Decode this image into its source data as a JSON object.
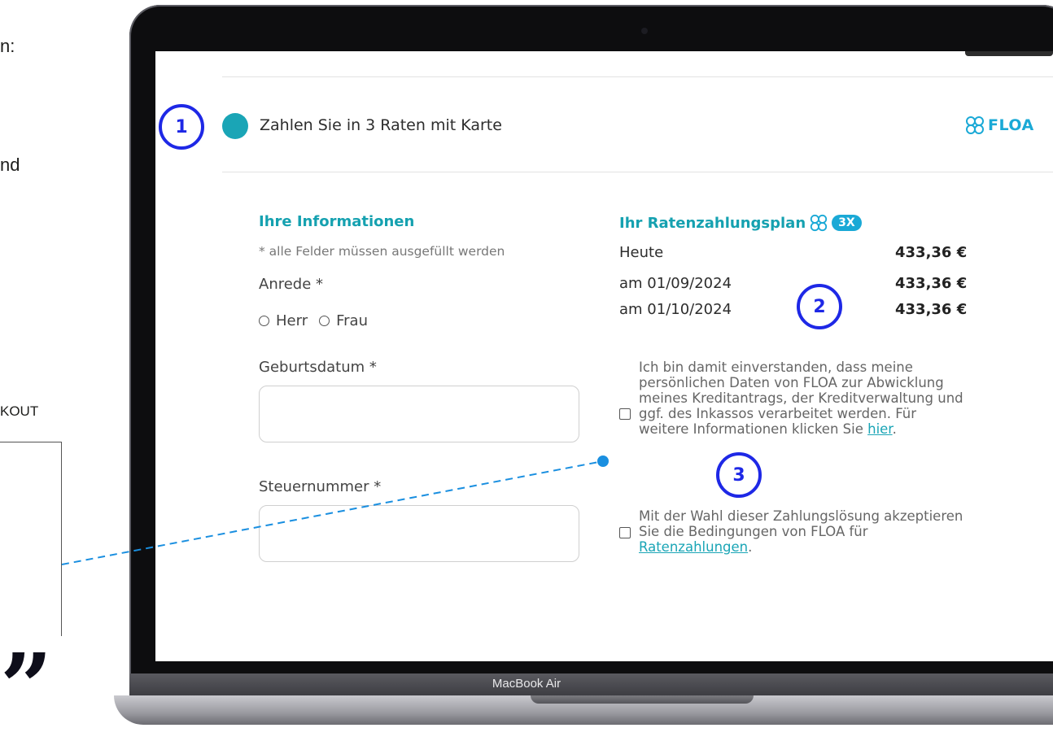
{
  "left_panel": {
    "fragment_1": "n:",
    "fragment_2": "nd",
    "fragment_3": "KOUT",
    "quote_mark": "”"
  },
  "laptop": {
    "brand": "MacBook Air"
  },
  "payment": {
    "option_label": "Zahlen Sie in 3 Raten mit Karte",
    "provider": "FLOA",
    "selected_color": "#1aa5b6",
    "provider_color": "#1aa9d6"
  },
  "info": {
    "title": "Ihre Informationen",
    "required_note": "* alle Felder müssen ausgefüllt werden",
    "salutation_label": "Anrede *",
    "salutation_options": [
      "Herr",
      "Frau"
    ],
    "birthdate_label": "Geburtsdatum *",
    "birthdate_value": "",
    "tax_label": "Steuernummer *",
    "tax_value": ""
  },
  "plan": {
    "title": "Ihr Ratenzahlungsplan",
    "badge": "3X",
    "rows": [
      {
        "date": "Heute",
        "amount": "433,36 €"
      },
      {
        "date": "am 01/09/2024",
        "amount": "433,36 €"
      },
      {
        "date": "am 01/10/2024",
        "amount": "433,36 €"
      }
    ]
  },
  "consent": {
    "first_text": "Ich bin damit einverstanden, dass meine persönlichen Daten von FLOA zur Abwicklung meines Kreditantrags, der Kreditverwaltung und ggf. des Inkassos verarbeitet werden. Für weitere Informationen klicken Sie ",
    "first_link": "hier",
    "first_end": ".",
    "second_text": "Mit der Wahl dieser Zahlungslösung akzeptieren Sie die Bedingungen von FLOA für ",
    "second_link": "Ratenzahlungen",
    "second_end": "."
  },
  "markers": [
    "1",
    "2",
    "3"
  ],
  "marker_color": "#1e28e6",
  "annotation_line_color": "#1a8fe0"
}
